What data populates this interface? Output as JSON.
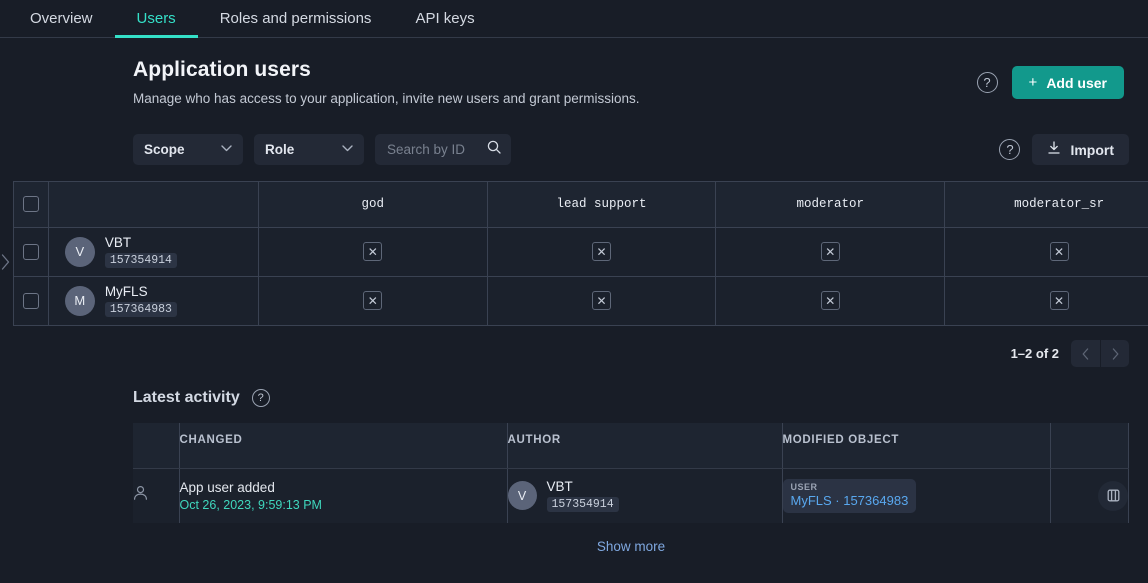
{
  "tabs": [
    {
      "label": "Overview",
      "active": false
    },
    {
      "label": "Users",
      "active": true
    },
    {
      "label": "Roles and permissions",
      "active": false
    },
    {
      "label": "API keys",
      "active": false
    }
  ],
  "header": {
    "title": "Application users",
    "subtitle": "Manage who has access to your application, invite new users and grant permissions.",
    "help_glyph": "?",
    "add_user_label": "Add user",
    "add_user_plus": "+",
    "accent_color": "#12998c"
  },
  "filters": {
    "scope_label": "Scope",
    "role_label": "Role",
    "chevron": "⌄",
    "search_placeholder": "Search by ID",
    "search_value": "",
    "help_glyph": "?",
    "import_label": "Import"
  },
  "table": {
    "columns": [
      "god",
      "lead support",
      "moderator",
      "moderator_sr"
    ],
    "rows": [
      {
        "initial": "V",
        "name": "VBT",
        "id": "157354914",
        "cells": [
          "✕",
          "✕",
          "✕",
          "✕"
        ]
      },
      {
        "initial": "M",
        "name": "MyFLS",
        "id": "157364983",
        "cells": [
          "✕",
          "✕",
          "✕",
          "✕"
        ]
      }
    ]
  },
  "pagination": {
    "count_label": "1–2 of 2",
    "prev_glyph": "‹",
    "next_glyph": "›"
  },
  "activity": {
    "title": "Latest activity",
    "help_glyph": "?",
    "columns": {
      "changed": "CHANGED",
      "author": "AUTHOR",
      "modified_object": "MODIFIED OBJECT"
    },
    "rows": [
      {
        "action": "App user added",
        "timestamp": "Oct 26, 2023, 9:59:13 PM",
        "author_initial": "V",
        "author_name": "VBT",
        "author_id": "157354914",
        "object_kind": "USER",
        "object_value": "MyFLS · 157364983"
      }
    ],
    "show_more_label": "Show more"
  }
}
